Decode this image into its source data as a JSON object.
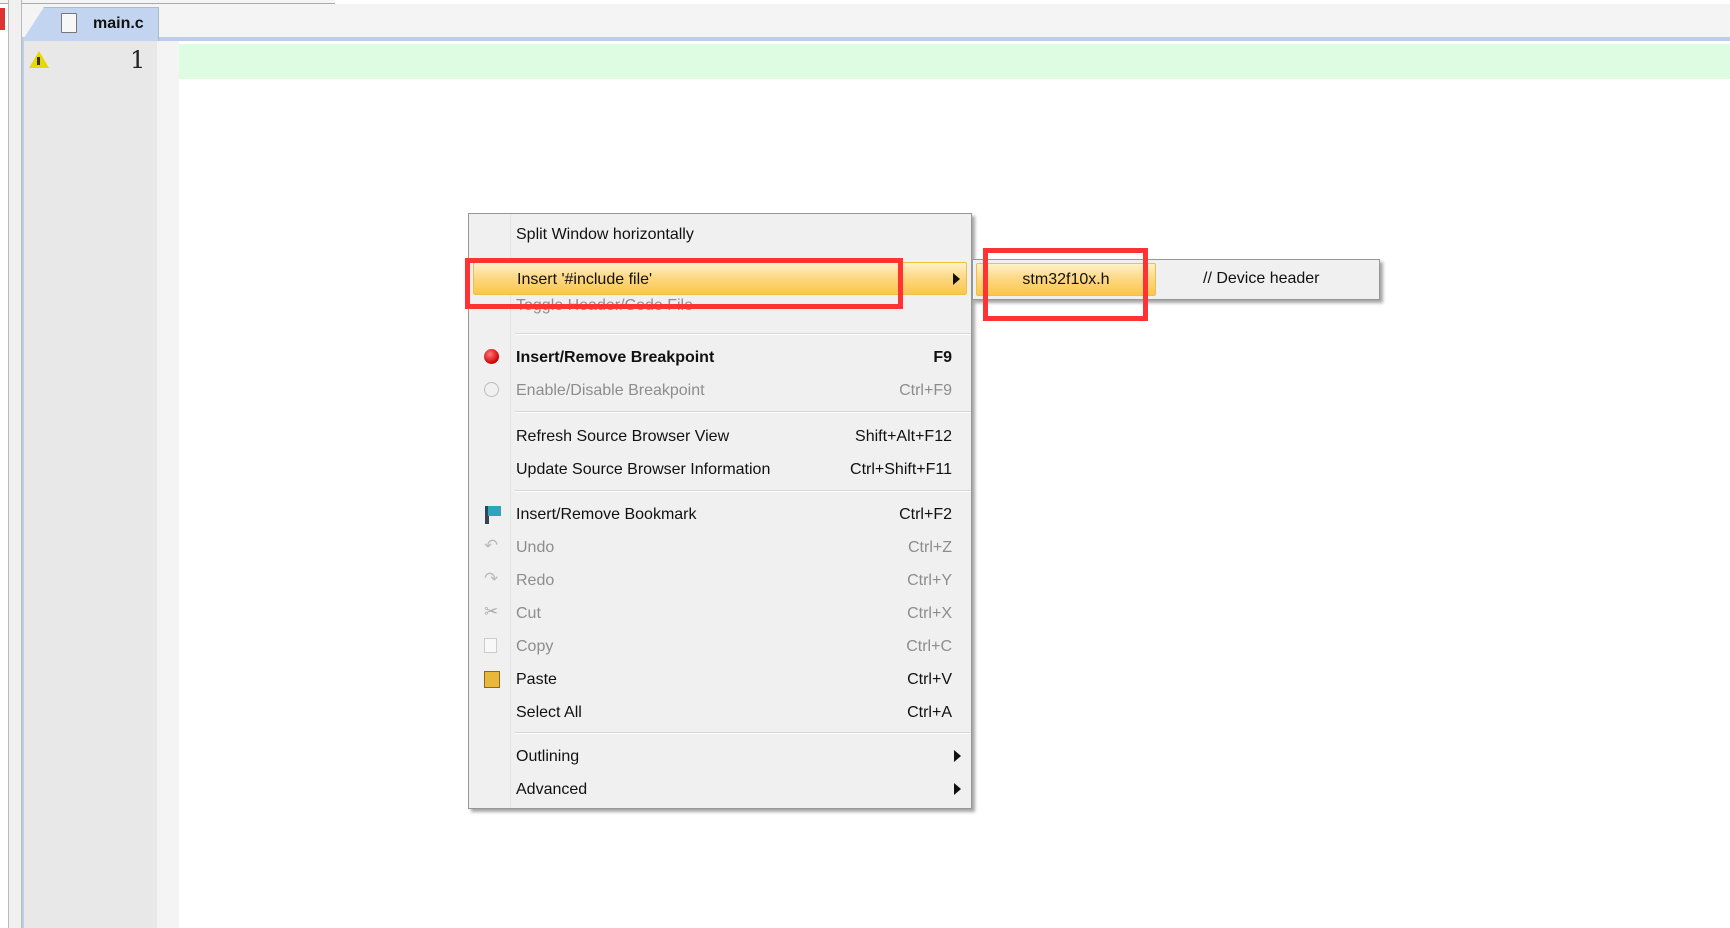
{
  "editor": {
    "tab_label": "main.c",
    "line_number": "1"
  },
  "context_menu": {
    "items": [
      {
        "label": "Split Window horizontally",
        "shortcut": ""
      },
      {
        "label": "Insert '#include file'",
        "shortcut": "",
        "submenu": true,
        "highlighted": true
      },
      {
        "label": "Toggle Header/Code File",
        "shortcut": "",
        "disabled": true
      },
      {
        "label": "Insert/Remove Breakpoint",
        "shortcut": "F9",
        "icon": "breakpoint-icon"
      },
      {
        "label": "Enable/Disable Breakpoint",
        "shortcut": "Ctrl+F9",
        "disabled": true,
        "icon": "breakpoint-outline-icon"
      },
      {
        "label": "Refresh Source Browser View",
        "shortcut": "Shift+Alt+F12"
      },
      {
        "label": "Update Source Browser Information",
        "shortcut": "Ctrl+Shift+F11"
      },
      {
        "label": "Insert/Remove Bookmark",
        "shortcut": "Ctrl+F2",
        "icon": "bookmark-flag-icon"
      },
      {
        "label": "Undo",
        "shortcut": "Ctrl+Z",
        "disabled": true,
        "icon": "undo-icon"
      },
      {
        "label": "Redo",
        "shortcut": "Ctrl+Y",
        "disabled": true,
        "icon": "redo-icon"
      },
      {
        "label": "Cut",
        "shortcut": "Ctrl+X",
        "disabled": true,
        "icon": "scissors-icon"
      },
      {
        "label": "Copy",
        "shortcut": "Ctrl+C",
        "disabled": true,
        "icon": "copy-icon"
      },
      {
        "label": "Paste",
        "shortcut": "Ctrl+V",
        "icon": "paste-icon"
      },
      {
        "label": "Select All",
        "shortcut": "Ctrl+A"
      },
      {
        "label": "Outlining",
        "shortcut": "",
        "submenu": true
      },
      {
        "label": "Advanced",
        "shortcut": "",
        "submenu": true
      }
    ]
  },
  "submenu": {
    "file": "stm32f10x.h",
    "description": "// Device header"
  },
  "colors": {
    "highlight": "#fdd680",
    "annotation_red": "#ff3333",
    "current_line": "#ddfce2"
  }
}
